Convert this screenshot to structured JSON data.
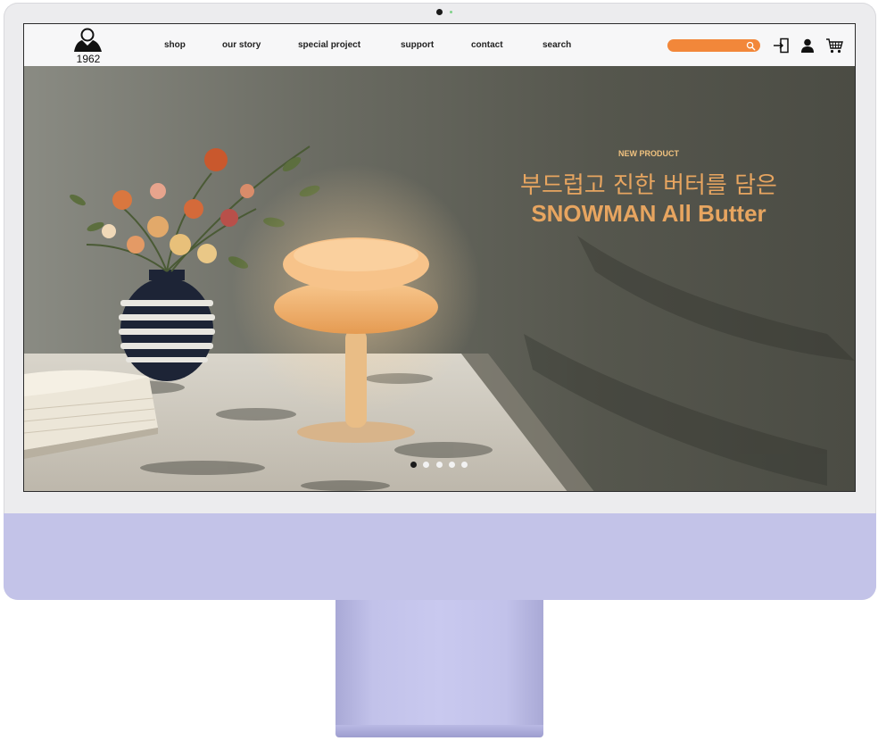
{
  "brand": {
    "logo_text": "1962"
  },
  "nav": {
    "links": [
      "shop",
      "our story",
      "special project",
      "support",
      "contact",
      "search"
    ],
    "search_value": "",
    "icons": [
      "login-icon",
      "user-icon",
      "cart-icon"
    ]
  },
  "hero": {
    "kicker": "NEW PRODUCT",
    "title_ko": "부드럽고 진한 버터를 담은",
    "title_en": "SNOWMAN All Butter",
    "slides_total": 5,
    "active_slide": 1
  },
  "colors": {
    "accent": "#f2873a",
    "hero_text": "#e7a560",
    "monitor_chin": "#c3c3e8"
  }
}
